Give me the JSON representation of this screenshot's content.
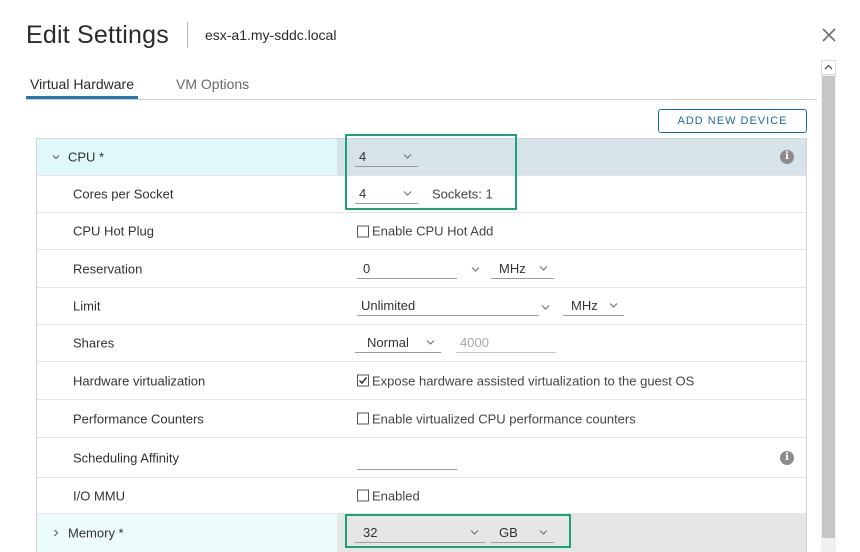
{
  "dialog": {
    "title": "Edit Settings",
    "subtitle": "esx-a1.my-sddc.local",
    "close_icon": "close-icon"
  },
  "tabs": [
    {
      "label": "Virtual Hardware",
      "active": true
    },
    {
      "label": "VM Options",
      "active": false
    }
  ],
  "toolbar": {
    "add_device_label": "ADD NEW DEVICE"
  },
  "cpu": {
    "label": "CPU *",
    "count": "4",
    "cores_per_socket": {
      "label": "Cores per Socket",
      "value": "4",
      "sockets_text": "Sockets: 1"
    },
    "hot_plug": {
      "label": "CPU Hot Plug",
      "checkbox_label": "Enable CPU Hot Add",
      "checked": false
    },
    "reservation": {
      "label": "Reservation",
      "value": "0",
      "unit": "MHz"
    },
    "limit": {
      "label": "Limit",
      "value": "Unlimited",
      "unit": "MHz"
    },
    "shares": {
      "label": "Shares",
      "level": "Normal",
      "value": "4000"
    },
    "hw_virtualization": {
      "label": "Hardware virtualization",
      "checkbox_label": "Expose hardware assisted virtualization to the guest OS",
      "checked": true
    },
    "perf_counters": {
      "label": "Performance Counters",
      "checkbox_label": "Enable virtualized CPU performance counters",
      "checked": false
    },
    "scheduling_affinity": {
      "label": "Scheduling Affinity",
      "value": ""
    },
    "io_mmu": {
      "label": "I/O MMU",
      "checkbox_label": "Enabled",
      "checked": false
    }
  },
  "memory": {
    "label": "Memory *",
    "value": "32",
    "unit": "GB"
  },
  "colors": {
    "accent": "#1f77b8",
    "highlight": "#1aa37a",
    "cpu_row_bg": "#dff8f9",
    "button_text": "#1d6ca0"
  }
}
